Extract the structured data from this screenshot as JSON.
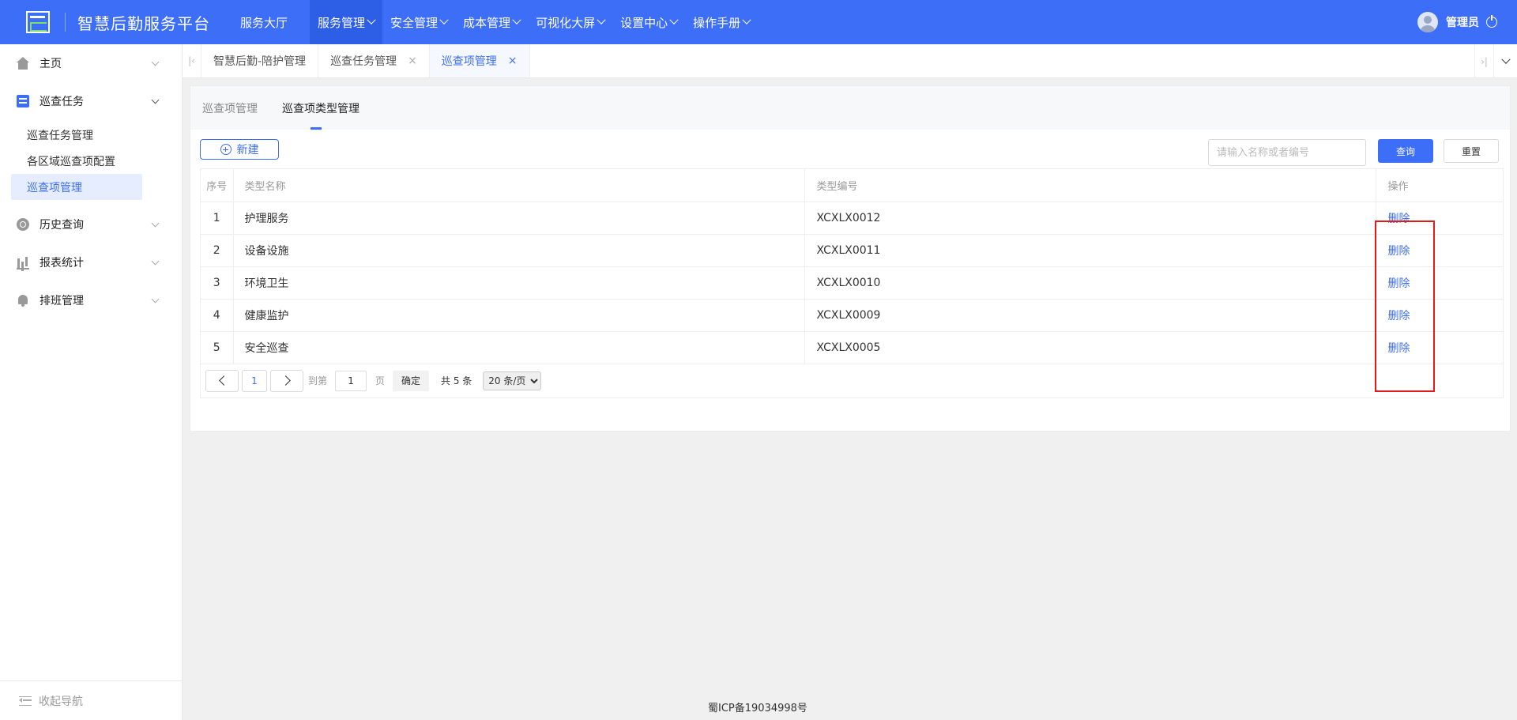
{
  "header": {
    "app_title": "智慧后勤服务平台",
    "nav": [
      {
        "label": "服务大厅"
      },
      {
        "label": "服务管理"
      },
      {
        "label": "安全管理"
      },
      {
        "label": "成本管理"
      },
      {
        "label": "可视化大屏"
      },
      {
        "label": "设置中心"
      },
      {
        "label": "操作手册"
      }
    ],
    "user_name": "管理员"
  },
  "sidebar": {
    "items": [
      {
        "label": "主页"
      },
      {
        "label": "巡查任务"
      },
      {
        "label": "历史查询"
      },
      {
        "label": "报表统计"
      },
      {
        "label": "排班管理"
      }
    ],
    "sub_items": [
      {
        "label": "巡查任务管理"
      },
      {
        "label": "各区域巡查项配置"
      },
      {
        "label": "巡查项管理"
      }
    ],
    "collapse_label": "收起导航"
  },
  "tabs": [
    {
      "label": "智慧后勤-陪护管理"
    },
    {
      "label": "巡查任务管理"
    },
    {
      "label": "巡查项管理"
    }
  ],
  "subtabs": [
    {
      "label": "巡查项管理"
    },
    {
      "label": "巡查项类型管理"
    }
  ],
  "toolbar": {
    "new_label": "新建",
    "search_placeholder": "请输入名称或者编号",
    "query_label": "查询",
    "reset_label": "重置"
  },
  "table": {
    "headers": [
      "序号",
      "类型名称",
      "类型编号",
      "操作"
    ],
    "rows": [
      {
        "idx": "1",
        "name": "护理服务",
        "code": "XCXLX0012",
        "action": "删除"
      },
      {
        "idx": "2",
        "name": "设备设施",
        "code": "XCXLX0011",
        "action": "删除"
      },
      {
        "idx": "3",
        "name": "环境卫生",
        "code": "XCXLX0010",
        "action": "删除"
      },
      {
        "idx": "4",
        "name": "健康监护",
        "code": "XCXLX0009",
        "action": "删除"
      },
      {
        "idx": "5",
        "name": "安全巡查",
        "code": "XCXLX0005",
        "action": "删除"
      }
    ]
  },
  "pagination": {
    "current_page": "1",
    "goto_label": "到第",
    "goto_value": "1",
    "page_label": "页",
    "confirm_label": "确定",
    "total_label": "共 5 条",
    "page_size": "20 条/页"
  },
  "footer": {
    "icp": "蜀ICP备19034998号"
  },
  "colors": {
    "primary": "#3d6ef7",
    "highlight": "#e21c1c"
  }
}
